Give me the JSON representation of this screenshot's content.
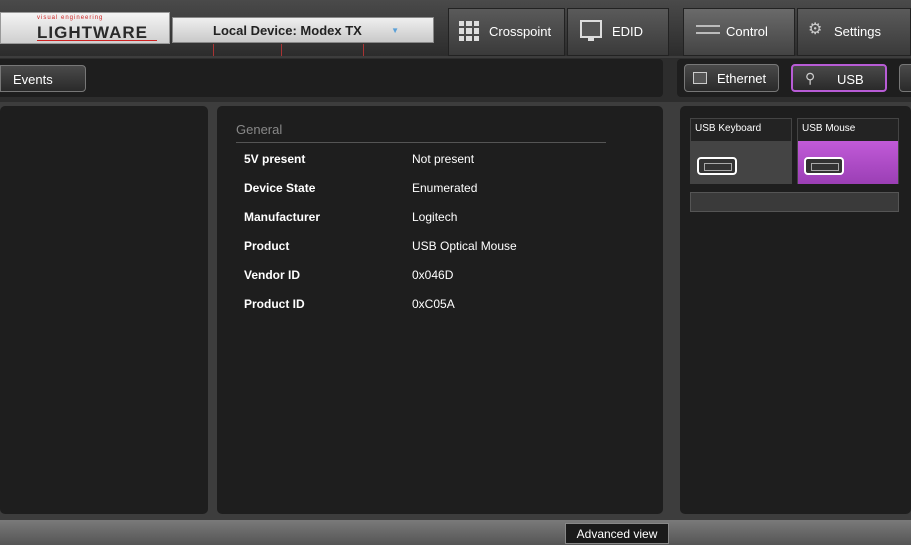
{
  "header": {
    "logo_small": "visual engineering",
    "logo_brand": "LIGHTWARE",
    "device_label": "Local Device: Modex TX",
    "tabs": [
      {
        "label": "Crosspoint",
        "icon": "grid-icon"
      },
      {
        "label": "EDID",
        "icon": "monitor-icon"
      },
      {
        "label": "Control",
        "icon": "control-icon",
        "active": true
      },
      {
        "label": "Settings",
        "icon": "gear-icon"
      }
    ]
  },
  "subbar": {
    "events_label": "Events",
    "ports": [
      {
        "label": "Ethernet",
        "icon": "ethernet-icon"
      },
      {
        "label": "USB",
        "icon": "usb-icon",
        "selected": true
      }
    ]
  },
  "details": {
    "section_title": "General",
    "rows": [
      {
        "key": "5V present",
        "value": "Not present"
      },
      {
        "key": "Device State",
        "value": "Enumerated"
      },
      {
        "key": "Manufacturer",
        "value": "Logitech"
      },
      {
        "key": "Product",
        "value": "USB Optical Mouse"
      },
      {
        "key": "Vendor ID",
        "value": "0x046D"
      },
      {
        "key": "Product ID",
        "value": "0xC05A"
      }
    ]
  },
  "usb_devices": [
    {
      "label": "USB Keyboard",
      "selected": false
    },
    {
      "label": "USB Mouse",
      "selected": true
    }
  ],
  "footer": {
    "advanced_label": "Advanced view"
  },
  "colors": {
    "accent": "#b85cd6",
    "panel_bg": "#1e1e1e"
  }
}
